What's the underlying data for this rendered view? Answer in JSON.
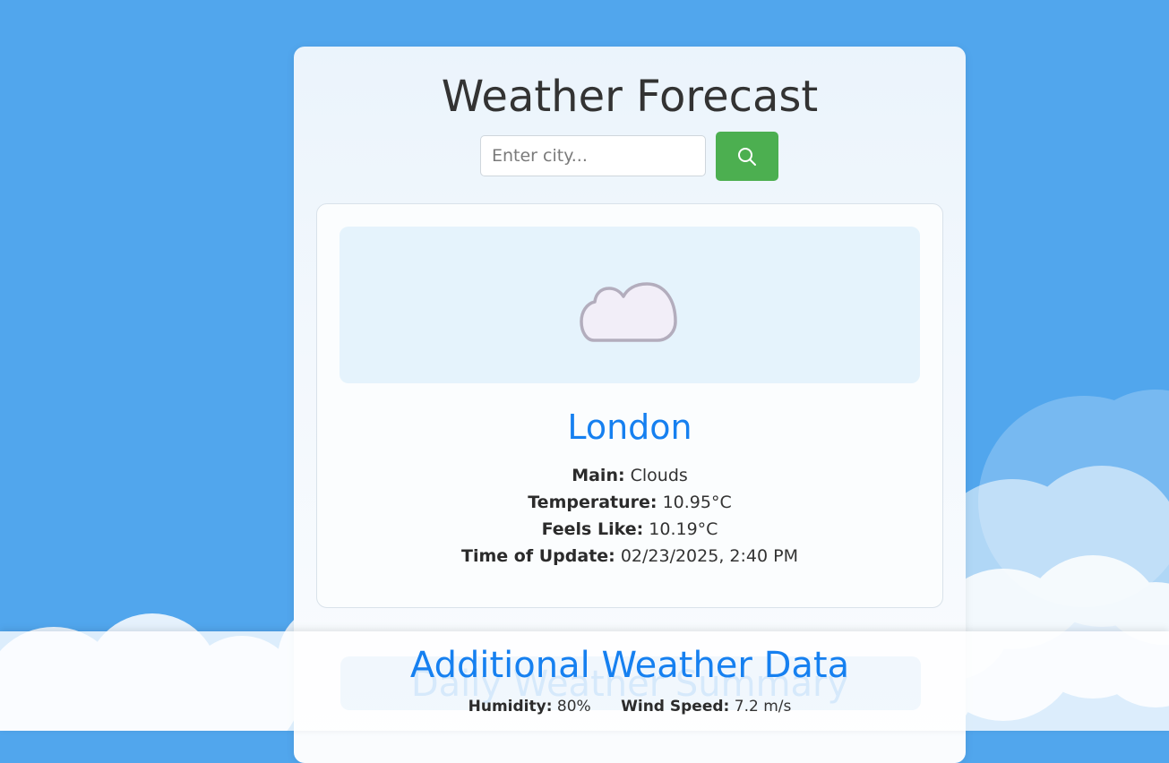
{
  "header": {
    "title": "Weather Forecast"
  },
  "search": {
    "placeholder": "Enter city...",
    "value": "",
    "button_icon": "search-icon"
  },
  "current_weather": {
    "icon": "cloud-icon",
    "city": "London",
    "details": [
      {
        "label": "Main:",
        "value": "Clouds"
      },
      {
        "label": "Temperature:",
        "value": "10.95°C"
      },
      {
        "label": "Feels Like:",
        "value": "10.19°C"
      },
      {
        "label": "Time of Update:",
        "value": "02/23/2025, 2:40 PM"
      }
    ]
  },
  "additional_data": {
    "heading": "Additional Weather Data",
    "obscured_heading": "Daily Weather Summary",
    "metrics": [
      {
        "label": "Humidity:",
        "value": "80%"
      },
      {
        "label": "Wind Speed:",
        "value": "7.2 m/s"
      }
    ]
  },
  "colors": {
    "background": "#51a6ed",
    "accent": "#1680f0",
    "search_button": "#4caf50",
    "icon_panel": "#e5f3fc",
    "cloud_fill": "#f2eef8",
    "cloud_stroke": "#b3adbd"
  }
}
